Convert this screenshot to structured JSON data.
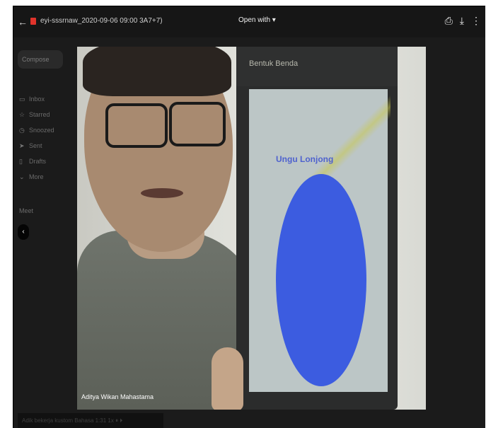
{
  "topbar": {
    "back_icon": "arrow-left",
    "file_icon": "video-file-icon",
    "file_name": "eyi-sssrnaw_2020-09-06 09:00 3A7+7)",
    "open_with": "Open with ▾",
    "right_icons": [
      "print-icon",
      "download-icon",
      "more-vert-icon"
    ]
  },
  "gmail_sidebar": {
    "compose_label": "Compose",
    "items": [
      {
        "icon": "inbox-icon",
        "label": "Inbox"
      },
      {
        "icon": "star-icon",
        "label": "Starred"
      },
      {
        "icon": "clock-icon",
        "label": "Snoozed"
      },
      {
        "icon": "send-icon",
        "label": "Sent"
      },
      {
        "icon": "draft-icon",
        "label": "Drafts"
      },
      {
        "icon": "chevron-icon",
        "label": "More"
      }
    ],
    "meet_label": "Meet"
  },
  "video": {
    "participant_name": "Aditya Wikan Mahastama",
    "phone_app_title": "Bentuk Benda",
    "shape_label": "Ungu Lonjong",
    "shape_color": "#3c5ce0"
  },
  "bottom_bar": {
    "text": "Adik bekerja kustom Bahasa   1:31   1x   ⏸   ⏵"
  }
}
